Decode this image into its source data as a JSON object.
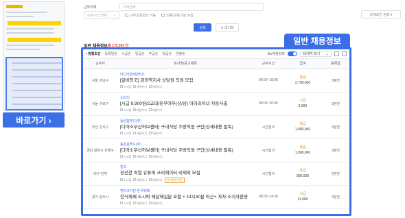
{
  "thumbnail": {
    "goto_label": "바로가기 ›"
  },
  "form": {
    "region_label": "근무지역",
    "region_placeholder": "지역선택",
    "period_label": "",
    "period_value": "근무기간 전체",
    "check1": "근무요일협의 가능",
    "check2": "인증/교육기관 모집",
    "detail_label": "상세조건 검색 ▾",
    "search_label": "검색",
    "reset_label": "↺ 초기화"
  },
  "section": {
    "title": "일반 채용정보",
    "count": "총 170,393 건"
  },
  "callout": "일반 채용정보",
  "toolbar": {
    "tabs": [
      "• 정렬조건",
      "등록일순",
      "시급순",
      "일급순",
      "주급순",
      "월급순",
      "연봉순"
    ],
    "toggle_label": "Biz채용정보",
    "sort_value": "50개씩 보기"
  },
  "table": {
    "headers": [
      "근무지",
      "회사명/공고제목",
      "근무시간",
      "급여",
      "등록일"
    ],
    "option_labels": [
      "스크랩",
      "채용하기",
      "채용보기"
    ],
    "rows": [
      {
        "location": "서울 강남구",
        "company": "아디아골새(하나)",
        "title": "[알바천국] 금정역지사 상담원 직원 모집",
        "time": "08:00~18:00",
        "pay_type": "월급",
        "pay": "2,700,000",
        "date": "3분전",
        "tag": ""
      },
      {
        "location": "서울 구로구",
        "company": "스터디",
        "title": "[시급 9,900원/2교대/휴무여부(상/상) 아이라이너 자동사출",
        "time": "08:00~20:00",
        "pay_type": "시급",
        "pay": "9,900",
        "date": "3분전",
        "tag": ""
      },
      {
        "location": "부산 강서구",
        "company": "동원홈푸드(주)",
        "title": "[디아소부산허브센터] 구내식당 주방직원 구인(상세내용 필독)",
        "time": "시간협의",
        "pay_type": "월급",
        "pay": "1,900,000",
        "date": "3분전",
        "tag": ""
      },
      {
        "location": "경남 창원시 진해구",
        "company": "동원홈푸드(주)",
        "title": "[디아소부산허브센터] 구내식당 주방직원 구인(상세내용 필독)",
        "time": "시간협의",
        "pay_type": "월급",
        "pay": "1,900,000",
        "date": "3분전",
        "tag": ""
      },
      {
        "location": "대구 전체",
        "company": "알고",
        "title": "정선한 최열 유튜버 크리에이터 비제작 모집",
        "time": "시간협의",
        "pay_type": "주급",
        "pay": "800,000",
        "date": "2분전",
        "tag": "인터넷/온라인"
      },
      {
        "location": "경기 용주시",
        "company": "빙탁고기원 한식뷔페",
        "title": "한식뷔페 도시락 배달해실분 포함 + 14시30분 퇴근+ 차차 소지자환영",
        "time": "08:00~14:30",
        "pay_type": "시급",
        "pay": "11,000",
        "date": "3분전",
        "tag": ""
      }
    ]
  }
}
